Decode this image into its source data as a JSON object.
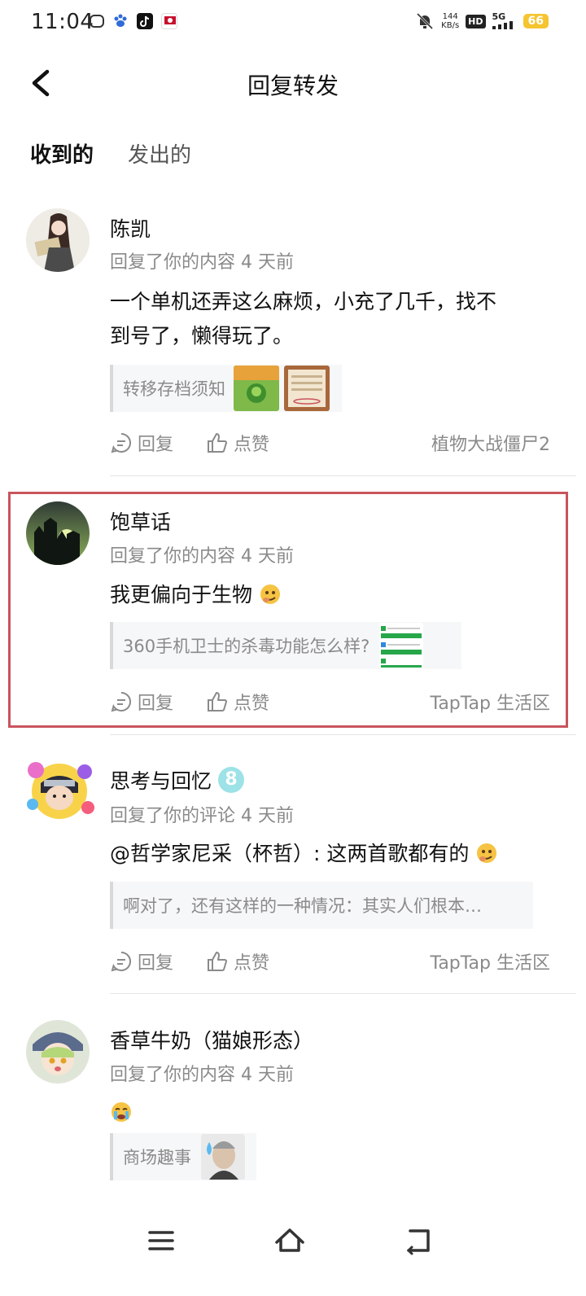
{
  "status_bar": {
    "time": "11:04",
    "net_speed_value": "144",
    "net_speed_unit": "KB/s",
    "hd_label": "HD",
    "signal_label": "5G",
    "battery": "66"
  },
  "header": {
    "title": "回复转发"
  },
  "tabs": [
    {
      "label": "收到的",
      "active": true
    },
    {
      "label": "发出的",
      "active": false
    }
  ],
  "action_labels": {
    "reply": "回复",
    "like": "点赞"
  },
  "items": [
    {
      "name": "陈凯",
      "meta": "回复了你的内容 4 天前",
      "content_line1": "一个单机还弄这么麻烦，小充了几千，找不",
      "content_line2": "到号了，懒得玩了。",
      "quote": "转移存档须知",
      "tag": "植物大战僵尸2"
    },
    {
      "name": "饱草话",
      "meta": "回复了你的内容 4 天前",
      "content": "我更偏向于生物",
      "quote": "360手机卫士的杀毒功能怎么样?",
      "tag": "TapTap 生活区"
    },
    {
      "name": "思考与回忆",
      "badge": "8",
      "meta": "回复了你的评论 4 天前",
      "content": "@哲学家尼采（杯哲）: 这两首歌都有的",
      "quote": "啊对了，还有这样的一种情况：其实人们根本…",
      "tag": "TapTap 生活区"
    },
    {
      "name": "香草牛奶（猫娘形态）",
      "meta": "回复了你的内容 4 天前",
      "quote": "商场趣事"
    }
  ],
  "colors": {
    "accent": "#15c5ce",
    "highlight_border": "#c9545d",
    "secondary_text": "#8a8a8a"
  }
}
